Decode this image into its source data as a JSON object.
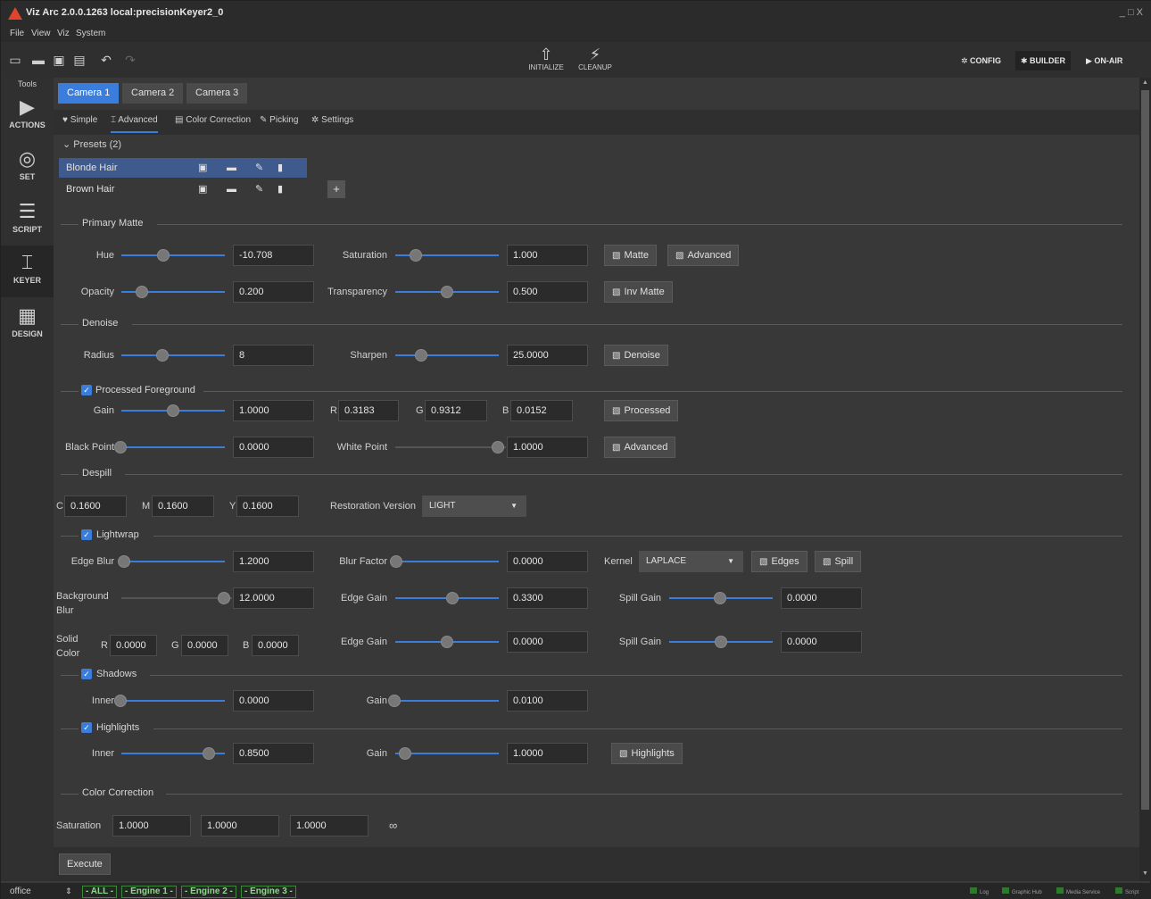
{
  "window": {
    "title": "Viz Arc 2.0.0.1263 local:precisionKeyer2_0",
    "controls": "_ □ X"
  },
  "menu": [
    "File",
    "View",
    "Viz",
    "System"
  ],
  "toolbar": {
    "initialize": "INITIALIZE",
    "cleanup": "CLEANUP",
    "config": "CONFIG",
    "builder": "BUILDER",
    "on_air": "ON-AIR"
  },
  "sidebar": {
    "title": "Tools",
    "items": [
      "ACTIONS",
      "SET",
      "SCRIPT",
      "KEYER",
      "DESIGN"
    ]
  },
  "camera_tabs": [
    "Camera 1",
    "Camera 2",
    "Camera 3"
  ],
  "sub_tabs": [
    "Simple",
    "Advanced",
    "Color Correction",
    "Picking",
    "Settings"
  ],
  "presets": {
    "header": "Presets (2)",
    "items": [
      "Blonde Hair",
      "Brown Hair"
    ]
  },
  "primary_matte": {
    "title": "Primary Matte",
    "hue": {
      "label": "Hue",
      "value": "-10.708"
    },
    "saturation": {
      "label": "Saturation",
      "value": "1.000"
    },
    "opacity": {
      "label": "Opacity",
      "value": "0.200"
    },
    "transparency": {
      "label": "Transparency",
      "value": "0.500"
    },
    "buttons": {
      "matte": "Matte",
      "advanced": "Advanced",
      "inv_matte": "Inv Matte"
    }
  },
  "denoise": {
    "title": "Denoise",
    "radius": {
      "label": "Radius",
      "value": "8"
    },
    "sharpen": {
      "label": "Sharpen",
      "value": "25.0000"
    },
    "button": "Denoise"
  },
  "processed_fg": {
    "title": "Processed Foreground",
    "gain": {
      "label": "Gain",
      "value": "1.0000"
    },
    "r": {
      "label": "R",
      "value": "0.3183"
    },
    "g": {
      "label": "G",
      "value": "0.9312"
    },
    "b": {
      "label": "B",
      "value": "0.0152"
    },
    "processed_button": "Processed",
    "black_point": {
      "label": "Black Point",
      "value": "0.0000"
    },
    "white_point": {
      "label": "White Point",
      "value": "1.0000"
    },
    "advanced_button": "Advanced"
  },
  "despill": {
    "title": "Despill",
    "c": {
      "label": "C",
      "value": "0.1600"
    },
    "m": {
      "label": "M",
      "value": "0.1600"
    },
    "y": {
      "label": "Y",
      "value": "0.1600"
    },
    "restoration": {
      "label": "Restoration Version",
      "value": "LIGHT"
    }
  },
  "lightwrap": {
    "title": "Lightwrap",
    "edge_blur": {
      "label": "Edge Blur",
      "value": "1.2000"
    },
    "blur_factor": {
      "label": "Blur Factor",
      "value": "0.0000"
    },
    "kernel": {
      "label": "Kernel",
      "value": "LAPLACE"
    },
    "edges_button": "Edges",
    "spill_button": "Spill",
    "background_blur": {
      "label1": "Background",
      "label2": "Blur",
      "value": "12.0000"
    },
    "edge_gain_1": {
      "label": "Edge Gain",
      "value": "0.3300"
    },
    "spill_gain_1": {
      "label": "Spill Gain",
      "value": "0.0000"
    },
    "solid_color": {
      "label1": "Solid",
      "label2": "Color",
      "r_label": "R",
      "r": "0.0000",
      "g_label": "G",
      "g": "0.0000",
      "b_label": "B",
      "b": "0.0000"
    },
    "edge_gain_2": {
      "label": "Edge Gain",
      "value": "0.0000"
    },
    "spill_gain_2": {
      "label": "Spill Gain",
      "value": "0.0000"
    }
  },
  "shadows": {
    "title": "Shadows",
    "inner": {
      "label": "Inner",
      "value": "0.0000"
    },
    "gain": {
      "label": "Gain",
      "value": "0.0100"
    }
  },
  "highlights": {
    "title": "Highlights",
    "inner": {
      "label": "Inner",
      "value": "0.8500"
    },
    "gain": {
      "label": "Gain",
      "value": "1.0000"
    },
    "button": "Highlights"
  },
  "color_correction": {
    "title": "Color Correction",
    "label": "Saturation",
    "values": [
      "1.0000",
      "1.0000",
      "1.0000"
    ]
  },
  "execute": "Execute",
  "statusbar": {
    "profile": "office",
    "engines": [
      "- ALL -",
      "- Engine 1 -",
      "- Engine 2 -",
      "- Engine 3 -"
    ],
    "status": [
      "Log",
      "Graphic Hub",
      "Media Service",
      "Script"
    ]
  },
  "colors": {
    "accent": "#3b7ddd",
    "preset_selected": "#3f5a8c",
    "engine_ok": "#8fd68f"
  }
}
